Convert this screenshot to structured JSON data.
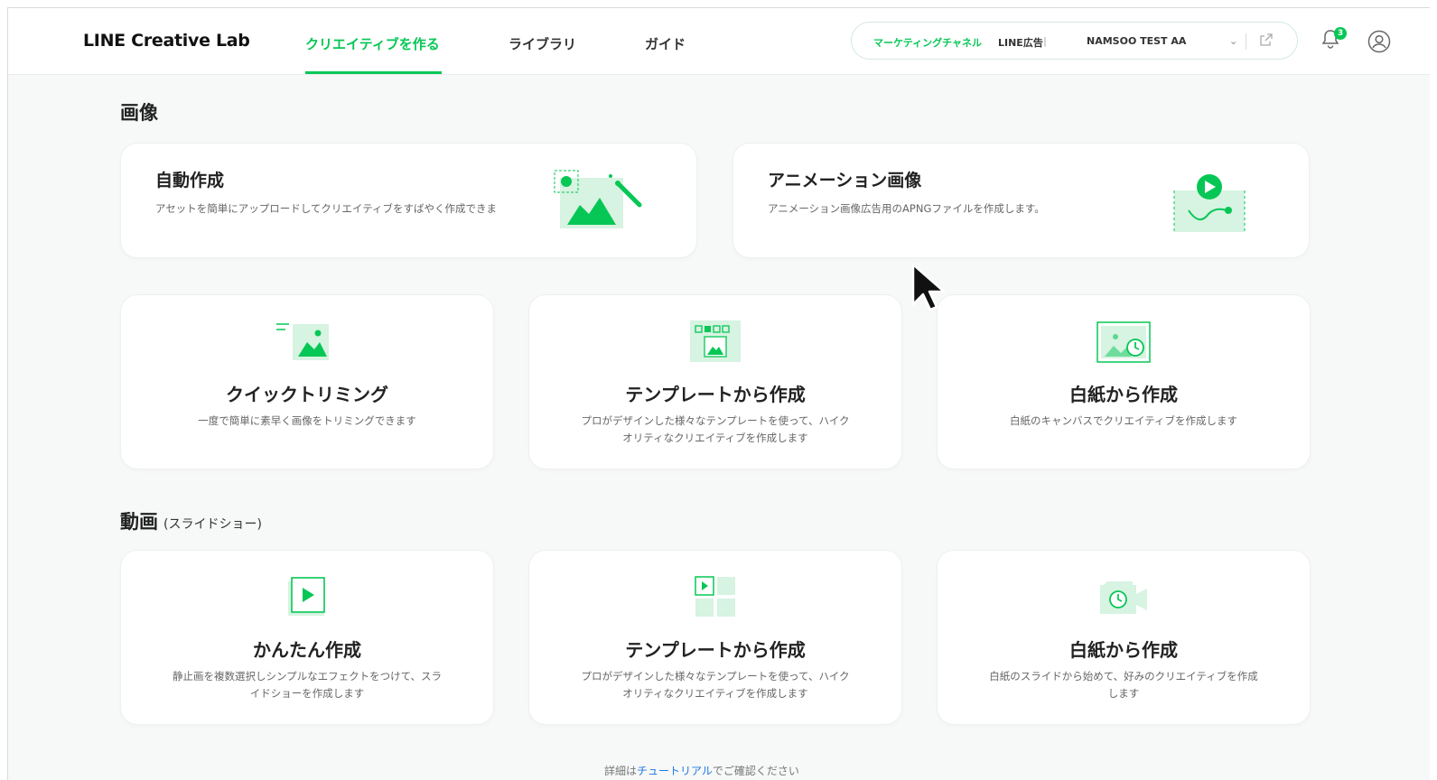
{
  "header": {
    "logo": "LINE Creative Lab",
    "tabs": [
      {
        "label": "クリエイティブを作る",
        "active": true
      },
      {
        "label": "ライブラリ",
        "active": false
      },
      {
        "label": "ガイド",
        "active": false
      }
    ],
    "channel": {
      "label": "マーケティングチャネル",
      "type": "LINE広告",
      "separator": "|",
      "account": "NAMSOO TEST AA",
      "chevron_icon": "chevron-down-icon",
      "external_icon": "external-link-icon"
    },
    "notification_count": "3",
    "user_icon": "user-circle-icon",
    "accent_color": "#06c755"
  },
  "image_section": {
    "title": "画像",
    "wide_cards": [
      {
        "title": "自動作成",
        "desc": "アセットを簡単にアップロードしてクリエイティブをすばやく作成できま",
        "icon": "auto-create-illustration"
      },
      {
        "title": "アニメーション画像",
        "desc": "アニメーション画像広告用のAPNGファイルを作成します。",
        "icon": "animation-image-illustration"
      }
    ],
    "cards": [
      {
        "title": "クイックトリミング",
        "desc": "一度で簡単に素早く画像をトリミングできます",
        "icon": "quick-trim-icon"
      },
      {
        "title": "テンプレートから作成",
        "desc": "プロがデザインした様々なテンプレートを使って、ハイクオリティなクリエイティブを作成します",
        "icon": "template-image-icon"
      },
      {
        "title": "白紙から作成",
        "desc": "白紙のキャンバスでクリエイティブを作成します",
        "icon": "blank-canvas-icon"
      }
    ]
  },
  "video_section": {
    "title": "動画",
    "subtitle": "(スライドショー)",
    "cards": [
      {
        "title": "かんたん作成",
        "desc": "静止画を複数選択しシンプルなエフェクトをつけて、スライドショーを作成します",
        "icon": "easy-slideshow-icon"
      },
      {
        "title": "テンプレートから作成",
        "desc": "プロがデザインした様々なテンプレートを使って、ハイクオリティなクリエイティブを作成します",
        "icon": "template-video-icon"
      },
      {
        "title": "白紙から作成",
        "desc": "白紙のスライドから始めて、好みのクリエイティブを作成します",
        "icon": "blank-slide-icon"
      }
    ]
  },
  "footer": {
    "prefix": "詳細は",
    "link": "チュートリアル",
    "suffix": "でご確認ください"
  }
}
